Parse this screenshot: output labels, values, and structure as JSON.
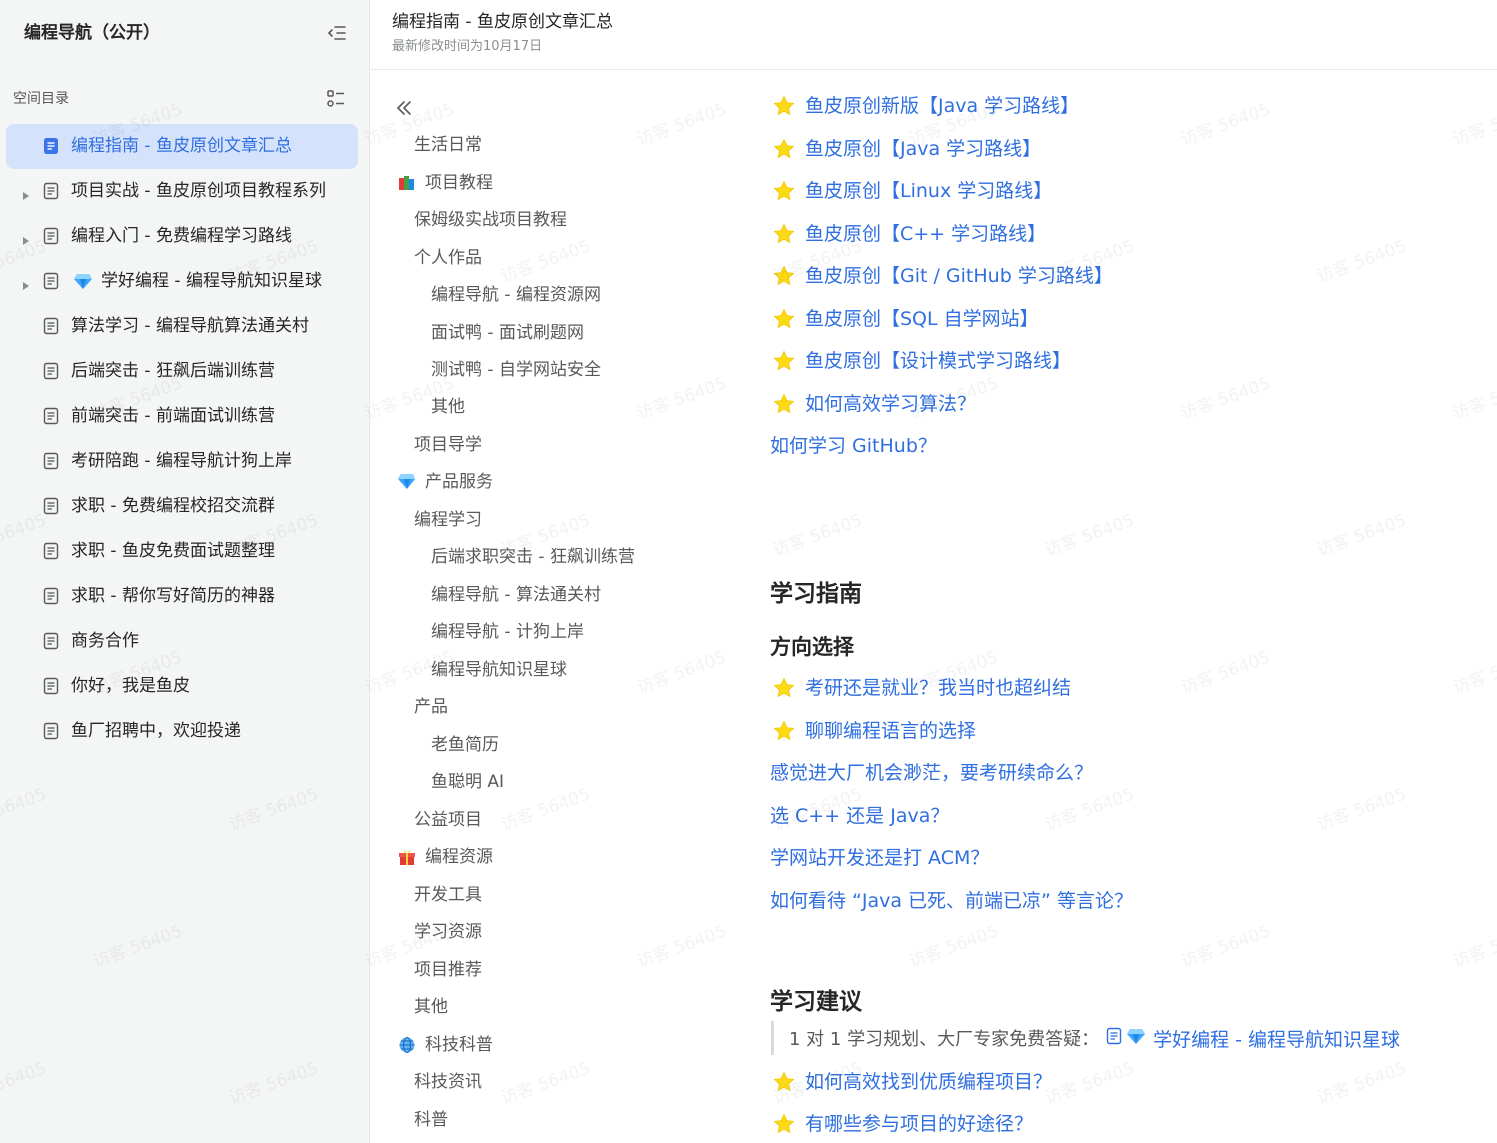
{
  "sidebar": {
    "title": "编程导航（公开）",
    "section_label": "空间目录",
    "items": [
      {
        "label": "编程指南 - 鱼皮原创文章汇总",
        "active": true,
        "caret": false,
        "gem": false
      },
      {
        "label": "项目实战 - 鱼皮原创项目教程系列",
        "active": false,
        "caret": true,
        "gem": false
      },
      {
        "label": "编程入门 - 免费编程学习路线",
        "active": false,
        "caret": true,
        "gem": false
      },
      {
        "label": "学好编程 - 编程导航知识星球",
        "active": false,
        "caret": true,
        "gem": true
      },
      {
        "label": "算法学习 - 编程导航算法通关村",
        "active": false,
        "caret": false,
        "gem": false
      },
      {
        "label": "后端突击 - 狂飙后端训练营",
        "active": false,
        "caret": false,
        "gem": false
      },
      {
        "label": "前端突击 - 前端面试训练营",
        "active": false,
        "caret": false,
        "gem": false
      },
      {
        "label": "考研陪跑 - 编程导航计狗上岸",
        "active": false,
        "caret": false,
        "gem": false
      },
      {
        "label": "求职 - 免费编程校招交流群",
        "active": false,
        "caret": false,
        "gem": false
      },
      {
        "label": "求职 - 鱼皮免费面试题整理",
        "active": false,
        "caret": false,
        "gem": false
      },
      {
        "label": "求职 - 帮你写好简历的神器",
        "active": false,
        "caret": false,
        "gem": false
      },
      {
        "label": "商务合作",
        "active": false,
        "caret": false,
        "gem": false
      },
      {
        "label": "你好，我是鱼皮",
        "active": false,
        "caret": false,
        "gem": false
      },
      {
        "label": "鱼厂招聘中，欢迎投递",
        "active": false,
        "caret": false,
        "gem": false
      }
    ]
  },
  "header": {
    "title": "编程指南 - 鱼皮原创文章汇总",
    "subtitle": "最新修改时间为10月17日"
  },
  "toc": {
    "items": [
      {
        "label": "生活日常",
        "level": 1,
        "emoji": ""
      },
      {
        "label": "项目教程",
        "level": 0,
        "emoji": "books"
      },
      {
        "label": "保姆级实战项目教程",
        "level": 1,
        "emoji": ""
      },
      {
        "label": "个人作品",
        "level": 1,
        "emoji": ""
      },
      {
        "label": "编程导航 - 编程资源网",
        "level": 2,
        "emoji": ""
      },
      {
        "label": "面试鸭 - 面试刷题网",
        "level": 2,
        "emoji": ""
      },
      {
        "label": "测试鸭 - 自学网站安全",
        "level": 2,
        "emoji": ""
      },
      {
        "label": "其他",
        "level": 2,
        "emoji": ""
      },
      {
        "label": "项目导学",
        "level": 1,
        "emoji": ""
      },
      {
        "label": "产品服务",
        "level": 0,
        "emoji": "gem"
      },
      {
        "label": "编程学习",
        "level": 1,
        "emoji": ""
      },
      {
        "label": "后端求职突击 - 狂飙训练营",
        "level": 2,
        "emoji": ""
      },
      {
        "label": "编程导航 - 算法通关村",
        "level": 2,
        "emoji": ""
      },
      {
        "label": "编程导航 - 计狗上岸",
        "level": 2,
        "emoji": ""
      },
      {
        "label": "编程导航知识星球",
        "level": 2,
        "emoji": ""
      },
      {
        "label": "产品",
        "level": 1,
        "emoji": ""
      },
      {
        "label": "老鱼简历",
        "level": 2,
        "emoji": ""
      },
      {
        "label": "鱼聪明 AI",
        "level": 2,
        "emoji": ""
      },
      {
        "label": "公益项目",
        "level": 1,
        "emoji": ""
      },
      {
        "label": "编程资源",
        "level": 0,
        "emoji": "gift"
      },
      {
        "label": "开发工具",
        "level": 1,
        "emoji": ""
      },
      {
        "label": "学习资源",
        "level": 1,
        "emoji": ""
      },
      {
        "label": "项目推荐",
        "level": 1,
        "emoji": ""
      },
      {
        "label": "其他",
        "level": 1,
        "emoji": ""
      },
      {
        "label": "科技科普",
        "level": 0,
        "emoji": "globe"
      },
      {
        "label": "科技资讯",
        "level": 1,
        "emoji": ""
      },
      {
        "label": "科普",
        "level": 1,
        "emoji": ""
      }
    ]
  },
  "content": {
    "links_top": [
      {
        "label": "鱼皮原创新版【Java 学习路线】",
        "star": true
      },
      {
        "label": "鱼皮原创【Java 学习路线】",
        "star": true
      },
      {
        "label": "鱼皮原创【Linux 学习路线】",
        "star": true
      },
      {
        "label": "鱼皮原创【C++ 学习路线】",
        "star": true
      },
      {
        "label": "鱼皮原创【Git / GitHub 学习路线】",
        "star": true
      },
      {
        "label": "鱼皮原创【SQL 自学网站】",
        "star": true
      },
      {
        "label": "鱼皮原创【设计模式学习路线】",
        "star": true
      },
      {
        "label": "如何高效学习算法？",
        "star": true
      },
      {
        "label": "如何学习 GitHub？",
        "star": false
      }
    ],
    "h2_guide": "学习指南",
    "h3_direction": "方向选择",
    "links_direction": [
      {
        "label": "考研还是就业？我当时也超纠结",
        "star": true
      },
      {
        "label": "聊聊编程语言的选择",
        "star": true
      },
      {
        "label": "感觉进大厂机会渺茫，要考研续命么？",
        "star": false
      },
      {
        "label": "选 C++ 还是 Java？",
        "star": false
      },
      {
        "label": "学网站开发还是打 ACM？",
        "star": false
      },
      {
        "label": "如何看待 “Java 已死、前端已凉” 等言论？",
        "star": false
      }
    ],
    "h2_advice": "学习建议",
    "quote_text": "1 对 1 学习规划、大厂专家免费答疑：",
    "quote_link": "学好编程 - 编程导航知识星球",
    "links_advice": [
      {
        "label": "如何高效找到优质编程项目？",
        "star": true
      },
      {
        "label": "有哪些参与项目的好途径？",
        "star": true
      }
    ]
  },
  "watermark": "访客 56405",
  "colors": {
    "accent": "#2f6fe0",
    "active_bg": "#d5e2fb",
    "star": "#fadb14"
  }
}
